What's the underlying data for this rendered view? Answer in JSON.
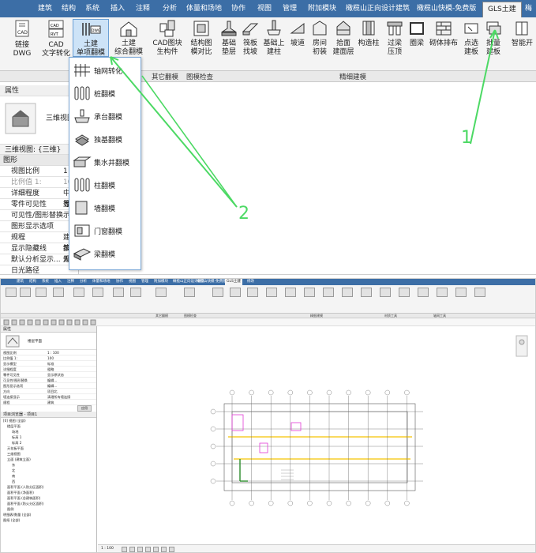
{
  "top": {
    "tabs": [
      "建筑",
      "结构",
      "系统",
      "插入",
      "注释",
      "分析",
      "体量和场地",
      "协作",
      "视图",
      "管理",
      "附加模块",
      "橄榄山正向设计建筑",
      "橄榄山快模-免费版",
      "GLS土建",
      "梅"
    ],
    "active_tab": "GLS土建",
    "ribbon_buttons": [
      {
        "label": "链接DWG",
        "icon": "cad-link-icon"
      },
      {
        "label": "CAD\n文字转化",
        "icon": "cad-text-icon"
      },
      {
        "label": "土建\n单项翻模",
        "icon": "dwg-single-icon"
      },
      {
        "label": "土建\n综合翻模",
        "icon": "house-dwg-icon"
      },
      {
        "label": "CAD图块\n生构件",
        "icon": "block-icon"
      },
      {
        "label": "结构图\n模对比",
        "icon": "compare-icon"
      },
      {
        "label": "基础\n垫层",
        "icon": "foundation-icon"
      },
      {
        "label": "筏板\n找坡",
        "icon": "raft-icon"
      },
      {
        "label": "基础上\n建柱",
        "icon": "column-on-foundation-icon"
      },
      {
        "label": "坡道",
        "icon": "ramp-icon"
      },
      {
        "label": "房间\n初装",
        "icon": "room-icon"
      },
      {
        "label": "拾面\n建面层",
        "icon": "floor-finish-icon"
      },
      {
        "label": "构造柱",
        "icon": "structural-column-icon"
      },
      {
        "label": "过梁\n压顶",
        "icon": "lintel-icon"
      },
      {
        "label": "圈梁",
        "icon": "ring-beam-icon"
      },
      {
        "label": "砌体排布",
        "icon": "masonry-icon"
      },
      {
        "label": "点选\n建板",
        "icon": "pick-slab-icon"
      },
      {
        "label": "批量\n建板",
        "icon": "batch-slab-icon"
      },
      {
        "label": "智能开",
        "icon": "smart-open-icon"
      }
    ],
    "groups": [
      "其它翻模",
      "图模检查",
      "精细建模"
    ],
    "properties": {
      "title": "属性",
      "type_label": "三维视图",
      "view_row": "三维视图: {三维}",
      "section": "图形",
      "rows": [
        {
          "k": "视图比例",
          "v": "1"
        },
        {
          "k": "比例值 1:",
          "v": "10"
        },
        {
          "k": "详细程度",
          "v": "中等"
        },
        {
          "k": "零件可见性",
          "v": "显示"
        },
        {
          "k": "可见性/图形替换",
          "v": ""
        },
        {
          "k": "图形显示选项",
          "v": ""
        },
        {
          "k": "规程",
          "v": "建筑"
        },
        {
          "k": "显示隐藏线",
          "v": "按规"
        },
        {
          "k": "默认分析显示...",
          "v": "无"
        },
        {
          "k": "日光路径",
          "v": ""
        }
      ]
    },
    "dropdown": [
      {
        "label": "轴网转化",
        "icon": "axis-grid-icon"
      },
      {
        "label": "桩翻模",
        "icon": "pile-icon"
      },
      {
        "label": "承台翻模",
        "icon": "pile-cap-icon"
      },
      {
        "label": "独基翻模",
        "icon": "isolated-footing-icon"
      },
      {
        "label": "集水井翻模",
        "icon": "sump-pit-icon"
      },
      {
        "label": "柱翻模",
        "icon": "column-icon"
      },
      {
        "label": "墙翻模",
        "icon": "wall-icon"
      },
      {
        "label": "门窗翻模",
        "icon": "door-window-icon"
      },
      {
        "label": "梁翻模",
        "icon": "beam-icon"
      }
    ],
    "annotations": [
      "1",
      "2"
    ],
    "accent": "#3c6ea6",
    "arrow_color": "#4cd964"
  },
  "bottom": {
    "tabs": [
      "建筑",
      "结构",
      "系统",
      "插入",
      "注释",
      "分析",
      "体量和场地",
      "协作",
      "视图",
      "管理",
      "附加模块",
      "橄榄山正向设计建筑",
      "橄榄山快模-免费版",
      "GLS土建",
      "修改"
    ],
    "groups": [
      "其它翻模",
      "图模检查",
      "精细建模",
      "材质工具",
      "轴网工具"
    ],
    "properties": {
      "header": "属性",
      "type_label": "楼层平面",
      "rows": [
        {
          "k": "视图比例",
          "v": "1 : 100"
        },
        {
          "k": "比例值 1:",
          "v": "100"
        },
        {
          "k": "显示模型",
          "v": "标准"
        },
        {
          "k": "详细程度",
          "v": "粗略"
        },
        {
          "k": "零件可见性",
          "v": "显示原状态"
        },
        {
          "k": "可见性/图形替换",
          "v": "编辑..."
        },
        {
          "k": "图形显示选项",
          "v": "编辑..."
        },
        {
          "k": "方向",
          "v": "项目北"
        },
        {
          "k": "墙连接显示",
          "v": "清理所有墙连接"
        },
        {
          "k": "规程",
          "v": "建筑"
        }
      ],
      "apply_label": "应用"
    },
    "browser_header": "项目浏览器 - 项目1",
    "tree": [
      "[0] 视图 (全部)",
      "楼层平面",
      "场地",
      "标高 1",
      "标高 2",
      "天花板平面",
      "三维视图",
      "立面 (建筑立面)",
      "东",
      "北",
      "南",
      "西",
      "面积平面 (人防分区面积)",
      "面积平面 (净面积)",
      "面积平面 (总建筑面积)",
      "面积平面 (防火分区面积)",
      "图例",
      "明细表/数量 (全部)",
      "图纸 (全部)"
    ],
    "scale_label": "1 : 100"
  }
}
